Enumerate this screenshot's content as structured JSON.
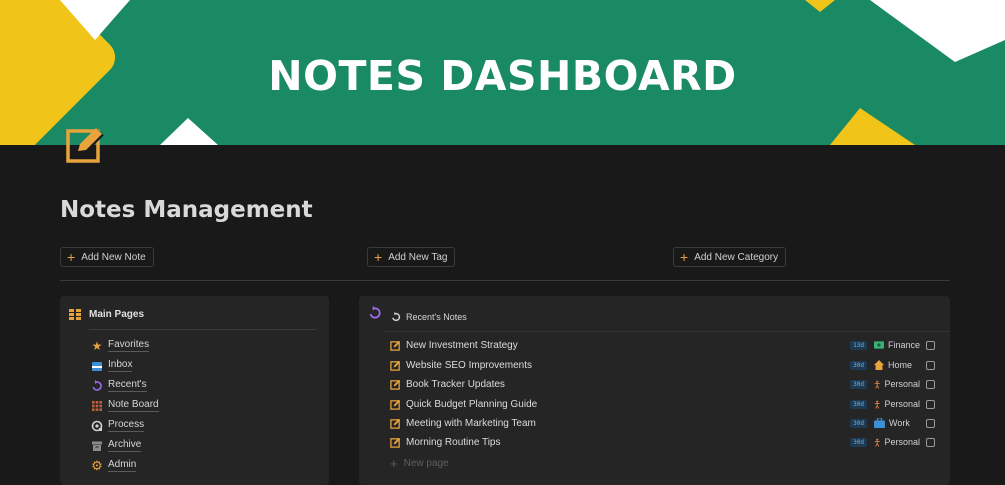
{
  "banner": {
    "title": "NOTES DASHBOARD"
  },
  "page": {
    "title": "Notes Management"
  },
  "actions": {
    "add_note": "Add New Note",
    "add_tag": "Add New Tag",
    "add_category": "Add New Category"
  },
  "main_pages": {
    "heading": "Main Pages",
    "items": [
      {
        "label": "Favorites",
        "icon": "star-icon"
      },
      {
        "label": "Inbox",
        "icon": "inbox-icon"
      },
      {
        "label": "Recent's",
        "icon": "refresh-icon"
      },
      {
        "label": "Note Board",
        "icon": "grid-icon"
      },
      {
        "label": "Process",
        "icon": "process-icon"
      },
      {
        "label": "Archive",
        "icon": "archive-icon"
      },
      {
        "label": "Admin",
        "icon": "gear-icon"
      }
    ]
  },
  "recent": {
    "heading": "Recent's Notes",
    "notes": [
      {
        "title": "New Investment Strategy",
        "age": "13d",
        "category": "Finance",
        "category_icon": "money-icon"
      },
      {
        "title": "Website SEO Improvements",
        "age": "30d",
        "category": "Home",
        "category_icon": "house-icon"
      },
      {
        "title": "Book Tracker Updates",
        "age": "30d",
        "category": "Personal",
        "category_icon": "person-icon"
      },
      {
        "title": "Quick Budget Planning Guide",
        "age": "30d",
        "category": "Personal",
        "category_icon": "person-icon"
      },
      {
        "title": "Meeting with Marketing Team",
        "age": "30d",
        "category": "Work",
        "category_icon": "briefcase-icon"
      },
      {
        "title": "Morning Routine Tips",
        "age": "30d",
        "category": "Personal",
        "category_icon": "person-icon"
      }
    ],
    "new_page": "New page"
  },
  "colors": {
    "banner": "#1a8a64",
    "accent_yellow": "#f0c419",
    "orange": "#e8a33d",
    "background": "#191919",
    "panel": "#252525"
  }
}
